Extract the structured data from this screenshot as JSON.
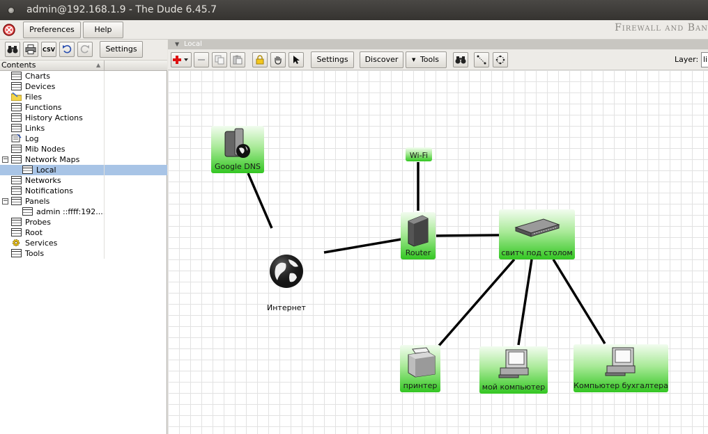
{
  "window": {
    "title": "admin@192.168.1.9 - The Dude 6.45.7"
  },
  "menu": {
    "preferences": "Preferences",
    "help": "Help",
    "brand": "Firewall and Ban"
  },
  "left_toolbar": {
    "csv": "CSV",
    "settings": "Settings"
  },
  "tree": {
    "header": "Contents",
    "items": [
      {
        "label": "Charts"
      },
      {
        "label": "Devices"
      },
      {
        "label": "Files"
      },
      {
        "label": "Functions"
      },
      {
        "label": "History Actions"
      },
      {
        "label": "Links"
      },
      {
        "label": "Log"
      },
      {
        "label": "Mib Nodes"
      },
      {
        "label": "Network Maps"
      },
      {
        "label": "Local"
      },
      {
        "label": "Networks"
      },
      {
        "label": "Notifications"
      },
      {
        "label": "Panels"
      },
      {
        "label": "admin ::ffff:192...."
      },
      {
        "label": "Probes"
      },
      {
        "label": "Root"
      },
      {
        "label": "Services"
      },
      {
        "label": "Tools"
      }
    ]
  },
  "map": {
    "tab": "Local",
    "toolbar": {
      "settings": "Settings",
      "discover": "Discover",
      "tools": "Tools",
      "layer_label": "Layer:",
      "layer_value": "li"
    },
    "nodes": {
      "google_dns": "Google DNS",
      "wifi": "Wi-Fi",
      "router": "Router",
      "switch": "свитч под столом",
      "internet": "Интернет",
      "printer": "принтер",
      "my_pc": "мой компьютер",
      "accountant_pc": "Компьютер бухгалтера"
    }
  },
  "colors": {
    "node_green": "#33c622",
    "selection": "#a8c4e6",
    "titlebar": "#3f3d3a"
  }
}
